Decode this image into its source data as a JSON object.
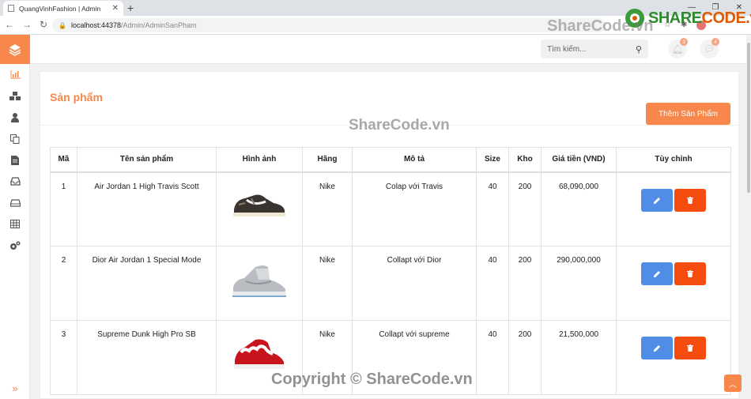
{
  "browser": {
    "tab_title": "QuangVinhFashion | Admin",
    "url_host": "localhost:44378",
    "url_path": "/Admin/AdminSanPham"
  },
  "header": {
    "search_placeholder": "Tìm kiếm...",
    "notification_count": "3",
    "message_count": "4"
  },
  "page": {
    "title": "Sản phẩm",
    "add_button": "Thêm Sản Phẩm"
  },
  "table": {
    "headers": [
      "Mã",
      "Tên sản phẩm",
      "Hình ảnh",
      "Hãng",
      "Mô tả",
      "Size",
      "Kho",
      "Giá tiền (VND)",
      "Tùy chỉnh"
    ],
    "rows": [
      {
        "id": "1",
        "name": "Air Jordan 1 High Travis Scott",
        "brand": "Nike",
        "desc": "Colap với Travis",
        "size": "40",
        "stock": "200",
        "price": "68,090,000",
        "image": "low-dark-sneaker-icon"
      },
      {
        "id": "2",
        "name": "Dior Air Jordan 1 Special Mode",
        "brand": "Nike",
        "desc": "Collapt với Dior",
        "size": "40",
        "stock": "200",
        "price": "290,000,000",
        "image": "high-grey-sneaker-icon"
      },
      {
        "id": "3",
        "name": "Supreme Dunk High Pro SB",
        "brand": "Nike",
        "desc": "Collapt với supreme",
        "size": "40",
        "stock": "200",
        "price": "21,500,000",
        "image": "red-white-sneaker-icon"
      }
    ]
  },
  "watermarks": {
    "logo_share": "SHARE",
    "logo_code": "CODE.vn",
    "top": "ShareCode.vn",
    "middle": "ShareCode.vn",
    "bottom": "Copyright © ShareCode.vn"
  },
  "colors": {
    "accent": "#f7874a",
    "edit": "#4f8de6",
    "delete": "#f54d0f"
  }
}
